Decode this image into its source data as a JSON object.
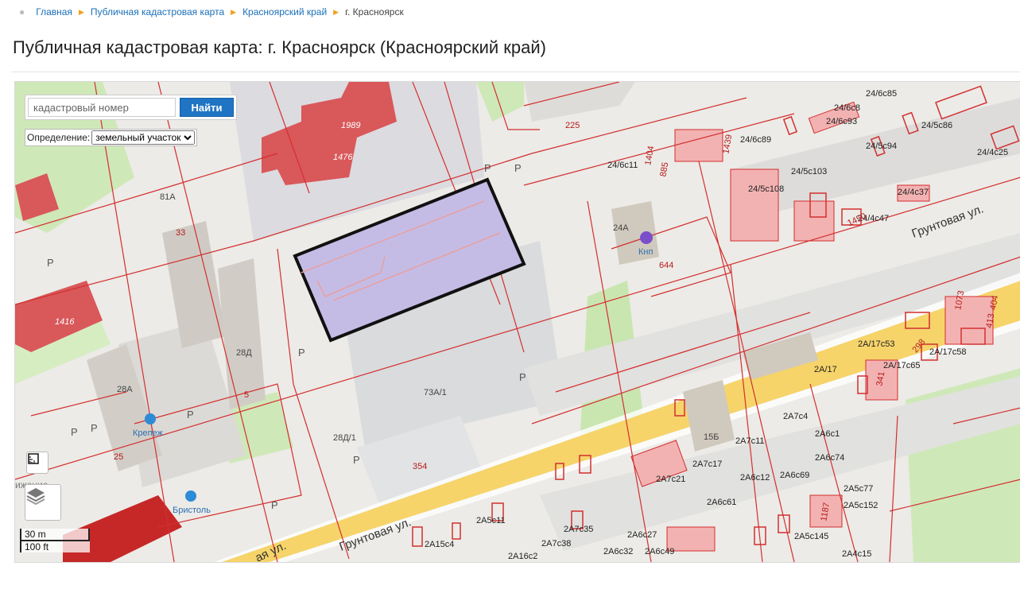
{
  "breadcrumb": {
    "items": [
      "Главная",
      "Публичная кадастровая карта",
      "Красноярский край"
    ],
    "current": "г. Красноярск"
  },
  "page_title": "Публичная кадастровая карта: г. Красноярск (Красноярский край)",
  "search": {
    "placeholder": "кадастровый номер",
    "button_label": "Найти"
  },
  "definition": {
    "label": "Определение:",
    "selected": "земельный участок"
  },
  "scale": {
    "metric": "30 m",
    "imperial": "100 ft"
  },
  "map_labels": {
    "street_1": "Грунтовая ул.",
    "street_2": "Грунтовая ул.",
    "street_3": "ая ул.",
    "poi_krepezh": "Крепеж",
    "poi_bristol": "Бристоль",
    "poi_knp": "Кнп",
    "district_edge": "ижение",
    "parcels": {
      "p1989": "1989",
      "p1476": "1476",
      "p1416": "1416",
      "p81a": "81А",
      "p33": "33",
      "p28d": "28Д",
      "p28a": "28А",
      "p5": "5",
      "p25": "25",
      "p225": "225",
      "p644": "644",
      "p24a": "24А",
      "p73a1": "73А/1",
      "p28d1": "28Д/1",
      "p354": "354",
      "p15b": "15Б",
      "p24_6c93": "24/6с93",
      "p24_6c8": "24/6с8",
      "p24_6c85": "24/6с85",
      "p24_6c89": "24/6с89",
      "p24_5c94": "24/5с94",
      "p24_5c86": "24/5с86",
      "p24_5c103": "24/5с103",
      "p24_5c108": "24/5с108",
      "p24_6c11": "24/6с11",
      "p24_4c25": "24/4с25",
      "p24_4c37": "24/4с37",
      "p24_4c47": "24/4с47",
      "p1450": "1450",
      "p885": "885",
      "p1404": "1404",
      "p1439": "1439",
      "p2a17c53": "2А/17с53",
      "p2a17c65": "2А/17с65",
      "p2a17c58": "2А/17с58",
      "p2a17": "2А/17",
      "p2a6c12": "2А6с12",
      "p2a6c69": "2А6с69",
      "p2a6c74": "2А6с74",
      "p2a6c61": "2А6с61",
      "p2a5c152": "2А5с152",
      "p2a5c77": "2А5с77",
      "p2a7c17": "2А7с17",
      "p2a7c21": "2А7с21",
      "p2a7c35": "2А7с35",
      "p2a7c38": "2А7с38",
      "p2a6c27": "2А6с27",
      "p2a6c32": "2А6с32",
      "p2a6c49": "2А6с49",
      "p2a5c11": "2А5с11",
      "p2a15c4": "2А15с4",
      "p2a16c2": "2А16с2",
      "p2a4c15": "2А4с15",
      "p2a5c145": "2А5с145",
      "p2a7c4": "2А7с4",
      "p2a7c11": "2А7с11",
      "p2a6c1": "2А6с1",
      "p413": "413",
      "p298": "298",
      "p1073": "1073",
      "p404": "404",
      "p341": "341",
      "p1187": "1187"
    }
  },
  "colors": {
    "link": "#1a6fb8",
    "button": "#1f75c4",
    "cadastral_line": "#d32f2f",
    "parcel_fill": "#f3b2b2",
    "building_red": "#d9585a",
    "road_yellow": "#f6d46a",
    "selection_fill": "#c5bce6",
    "park": "#cfe8b8"
  },
  "icons": [
    "map-pin-icon",
    "breadcrumb-arrow-icon",
    "ruler-icon",
    "layers-icon",
    "shop-icon",
    "parking-icon"
  ]
}
